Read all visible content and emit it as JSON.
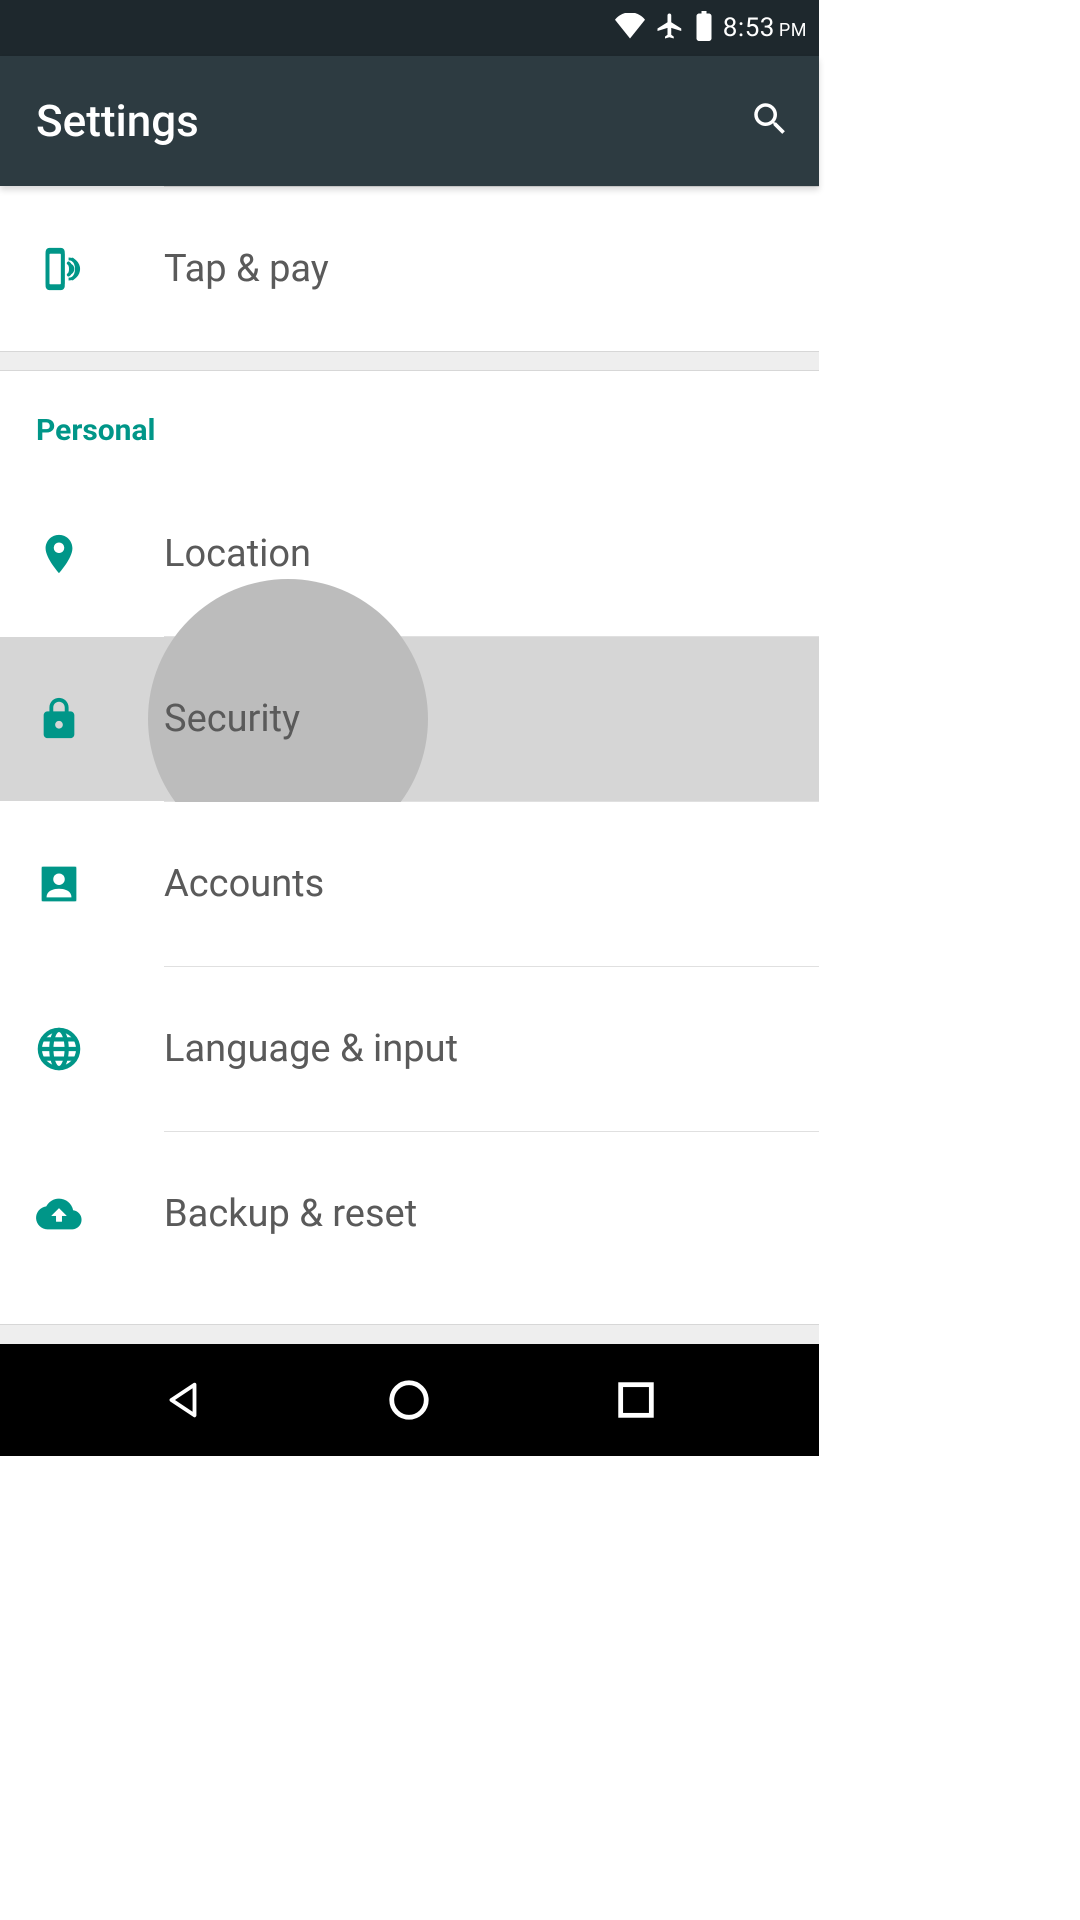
{
  "status_bar": {
    "time": "8:53",
    "ampm": "PM"
  },
  "app_bar": {
    "title": "Settings"
  },
  "items": {
    "tap_pay": "Tap & pay",
    "location": "Location",
    "security": "Security",
    "accounts": "Accounts",
    "language_input": "Language & input",
    "backup_reset": "Backup & reset"
  },
  "sections": {
    "personal": "Personal"
  }
}
